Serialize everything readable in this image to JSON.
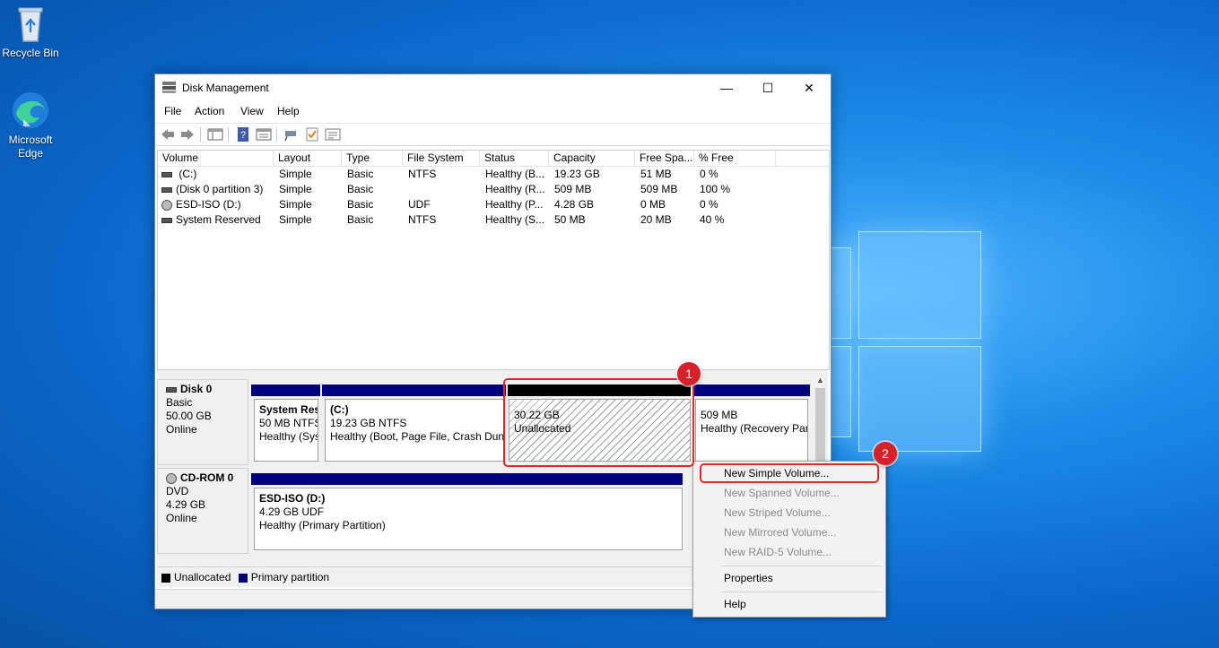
{
  "desktop": {
    "icons": [
      {
        "label": "Recycle Bin",
        "icon": "recycle-bin-icon"
      },
      {
        "label": "Microsoft Edge",
        "icon": "edge-icon"
      }
    ]
  },
  "window": {
    "title": "Disk Management",
    "menu": [
      "File",
      "Action",
      "View",
      "Help"
    ],
    "toolbar_icons": [
      "back-arrow-icon",
      "forward-arrow-icon",
      "console-tree-icon",
      "help-icon",
      "properties-icon",
      "connect-icon",
      "check-icon",
      "list-icon"
    ]
  },
  "volume_list": {
    "columns": [
      "Volume",
      "Layout",
      "Type",
      "File System",
      "Status",
      "Capacity",
      "Free Spa...",
      "% Free"
    ],
    "rows": [
      {
        "volume": " (C:)",
        "layout": "Simple",
        "type": "Basic",
        "fs": "NTFS",
        "status": "Healthy (B...",
        "capacity": "19.23 GB",
        "free": "51 MB",
        "pct": "0 %",
        "icon": "drive-icon"
      },
      {
        "volume": "(Disk 0 partition 3)",
        "layout": "Simple",
        "type": "Basic",
        "fs": "",
        "status": "Healthy (R...",
        "capacity": "509 MB",
        "free": "509 MB",
        "pct": "100 %",
        "icon": "drive-icon"
      },
      {
        "volume": "ESD-ISO (D:)",
        "layout": "Simple",
        "type": "Basic",
        "fs": "UDF",
        "status": "Healthy (P...",
        "capacity": "4.28 GB",
        "free": "0 MB",
        "pct": "0 %",
        "icon": "cdrom-icon"
      },
      {
        "volume": "System Reserved",
        "layout": "Simple",
        "type": "Basic",
        "fs": "NTFS",
        "status": "Healthy (S...",
        "capacity": "50 MB",
        "free": "20 MB",
        "pct": "40 %",
        "icon": "drive-icon"
      }
    ]
  },
  "disks": [
    {
      "name": "Disk 0",
      "kind": "Basic",
      "size": "50.00 GB",
      "state": "Online",
      "partitions": [
        {
          "name": "System Res",
          "line2": "50 MB NTFS",
          "line3": "Healthy (Sys",
          "kind": "primary"
        },
        {
          "name": " (C:)",
          "line2": "19.23 GB NTFS",
          "line3": "Healthy (Boot, Page File, Crash Dun",
          "kind": "primary"
        },
        {
          "name": "",
          "line2": "30.22 GB",
          "line3": "Unallocated",
          "kind": "unallocated"
        },
        {
          "name": "",
          "line2": "509 MB",
          "line3": "Healthy (Recovery Par",
          "kind": "primary"
        }
      ]
    },
    {
      "name": "CD-ROM 0",
      "kind": "DVD",
      "size": "4.29 GB",
      "state": "Online",
      "partitions": [
        {
          "name": "ESD-ISO  (D:)",
          "line2": "4.29 GB UDF",
          "line3": "Healthy (Primary Partition)",
          "kind": "primary"
        }
      ]
    }
  ],
  "legend": [
    {
      "label": "Unallocated",
      "color": "#000000"
    },
    {
      "label": "Primary partition",
      "color": "#00007f"
    }
  ],
  "context_menu": {
    "items": [
      {
        "label": "New Simple Volume...",
        "enabled": true
      },
      {
        "label": "New Spanned Volume...",
        "enabled": false
      },
      {
        "label": "New Striped Volume...",
        "enabled": false
      },
      {
        "label": "New Mirrored Volume...",
        "enabled": false
      },
      {
        "label": "New RAID-5 Volume...",
        "enabled": false
      },
      {
        "label": "Properties",
        "enabled": true
      },
      {
        "label": "Help",
        "enabled": true
      }
    ]
  },
  "annotations": {
    "step1": "1",
    "step2": "2",
    "accent": "#e0282f"
  }
}
